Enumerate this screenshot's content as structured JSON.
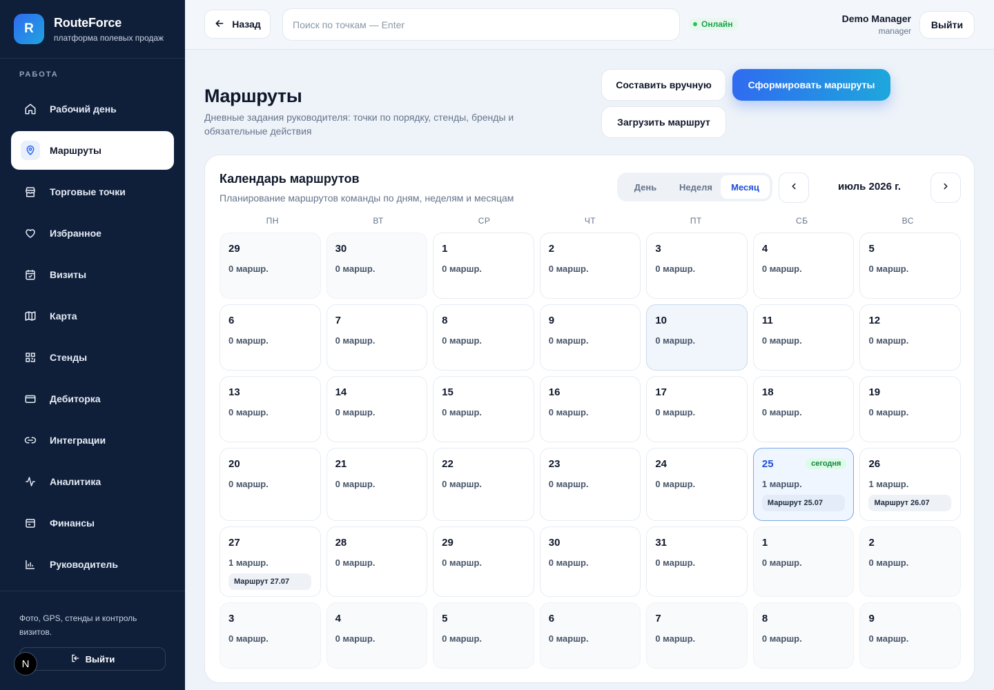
{
  "brand": {
    "logo_letter": "R",
    "name": "RouteForce",
    "subtitle": "платформа полевых продаж"
  },
  "sidebar": {
    "section_label": "РАБОТА",
    "items": [
      {
        "label": "Рабочий день",
        "icon": "home-icon"
      },
      {
        "label": "Маршруты",
        "icon": "map-pin-icon",
        "active": true
      },
      {
        "label": "Торговые точки",
        "icon": "store-icon"
      },
      {
        "label": "Избранное",
        "icon": "heart-icon"
      },
      {
        "label": "Визиты",
        "icon": "calendar-check-icon"
      },
      {
        "label": "Карта",
        "icon": "map-icon"
      },
      {
        "label": "Стенды",
        "icon": "qr-grid-icon"
      },
      {
        "label": "Дебиторка",
        "icon": "credit-card-icon"
      },
      {
        "label": "Интеграции",
        "icon": "link-icon"
      },
      {
        "label": "Аналитика",
        "icon": "activity-icon"
      },
      {
        "label": "Финансы",
        "icon": "wallet-icon"
      },
      {
        "label": "Руководитель",
        "icon": "bar-chart-icon"
      }
    ],
    "footer_text": "Фото, GPS, стенды и контроль визитов.",
    "logout_label": "Выйти",
    "badge_letter": "N"
  },
  "topbar": {
    "back_label": "Назад",
    "search_placeholder": "Поиск по точкам — Enter",
    "status": "Онлайн",
    "user_name": "Demo Manager",
    "user_role": "manager",
    "logout_label": "Выйти"
  },
  "page": {
    "title": "Маршруты",
    "subtitle": "Дневные задания руководителя: точки по порядку, стенды, бренды и обязательные действия",
    "btn_manual": "Составить вручную",
    "btn_generate": "Сформировать маршруты",
    "btn_upload": "Загрузить маршрут"
  },
  "calendar": {
    "title": "Календарь маршрутов",
    "subtitle": "Планирование маршрутов команды по дням, неделям и месяцам",
    "views": [
      "День",
      "Неделя",
      "Месяц"
    ],
    "active_view": "Месяц",
    "month_label": "июль 2026 г.",
    "weekdays": [
      "ПН",
      "ВТ",
      "СР",
      "ЧТ",
      "ПТ",
      "СБ",
      "ВС"
    ],
    "today_label": "сегодня",
    "weeks": [
      [
        {
          "day": "29",
          "count": "0 маршр.",
          "state": "out"
        },
        {
          "day": "30",
          "count": "0 маршр.",
          "state": "out"
        },
        {
          "day": "1",
          "count": "0 маршр."
        },
        {
          "day": "2",
          "count": "0 маршр."
        },
        {
          "day": "3",
          "count": "0 маршр."
        },
        {
          "day": "4",
          "count": "0 маршр."
        },
        {
          "day": "5",
          "count": "0 маршр."
        }
      ],
      [
        {
          "day": "6",
          "count": "0 маршр."
        },
        {
          "day": "7",
          "count": "0 маршр."
        },
        {
          "day": "8",
          "count": "0 маршр."
        },
        {
          "day": "9",
          "count": "0 маршр."
        },
        {
          "day": "10",
          "count": "0 маршр.",
          "state": "hl"
        },
        {
          "day": "11",
          "count": "0 маршр."
        },
        {
          "day": "12",
          "count": "0 маршр."
        }
      ],
      [
        {
          "day": "13",
          "count": "0 маршр."
        },
        {
          "day": "14",
          "count": "0 маршр."
        },
        {
          "day": "15",
          "count": "0 маршр."
        },
        {
          "day": "16",
          "count": "0 маршр."
        },
        {
          "day": "17",
          "count": "0 маршр."
        },
        {
          "day": "18",
          "count": "0 маршр."
        },
        {
          "day": "19",
          "count": "0 маршр."
        }
      ],
      [
        {
          "day": "20",
          "count": "0 маршр."
        },
        {
          "day": "21",
          "count": "0 маршр."
        },
        {
          "day": "22",
          "count": "0 маршр."
        },
        {
          "day": "23",
          "count": "0 маршр."
        },
        {
          "day": "24",
          "count": "0 маршр."
        },
        {
          "day": "25",
          "count": "1 маршр.",
          "state": "today",
          "routes": [
            "Маршрут 25.07"
          ]
        },
        {
          "day": "26",
          "count": "1 маршр.",
          "routes": [
            "Маршрут 26.07"
          ]
        }
      ],
      [
        {
          "day": "27",
          "count": "1 маршр.",
          "routes": [
            "Маршрут 27.07"
          ]
        },
        {
          "day": "28",
          "count": "0 маршр."
        },
        {
          "day": "29",
          "count": "0 маршр."
        },
        {
          "day": "30",
          "count": "0 маршр."
        },
        {
          "day": "31",
          "count": "0 маршр."
        },
        {
          "day": "1",
          "count": "0 маршр.",
          "state": "out"
        },
        {
          "day": "2",
          "count": "0 маршр.",
          "state": "out"
        }
      ],
      [
        {
          "day": "3",
          "count": "0 маршр.",
          "state": "out"
        },
        {
          "day": "4",
          "count": "0 маршр.",
          "state": "out"
        },
        {
          "day": "5",
          "count": "0 маршр.",
          "state": "out"
        },
        {
          "day": "6",
          "count": "0 маршр.",
          "state": "out"
        },
        {
          "day": "7",
          "count": "0 маршр.",
          "state": "out"
        },
        {
          "day": "8",
          "count": "0 маршр.",
          "state": "out"
        },
        {
          "day": "9",
          "count": "0 маршр.",
          "state": "out"
        }
      ]
    ]
  }
}
